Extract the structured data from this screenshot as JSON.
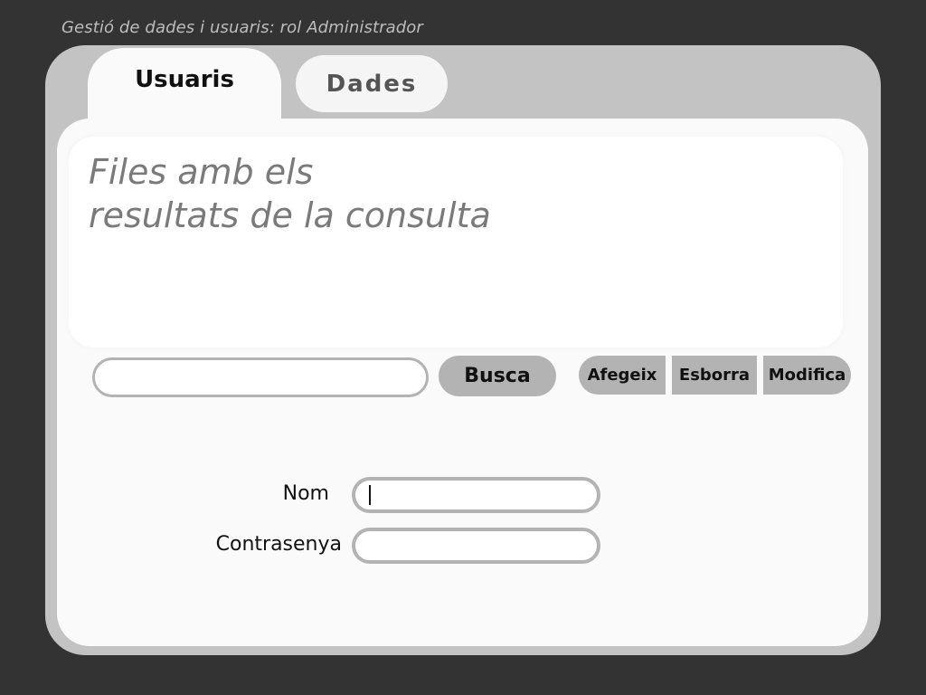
{
  "app": {
    "title": "Gestió de dades i usuaris: rol Administrador"
  },
  "tabs": [
    {
      "label": "Usuaris",
      "active": true
    },
    {
      "label": "Dades",
      "active": false
    }
  ],
  "results": {
    "placeholder_text": "Files amb els\nresultats de la consulta"
  },
  "search": {
    "value": "",
    "placeholder": "",
    "button_label": "Busca"
  },
  "actions": {
    "add_label": "Afegeix",
    "delete_label": "Esborra",
    "modify_label": "Modifica"
  },
  "form": {
    "name_label": "Nom",
    "name_value": "",
    "password_label": "Contrasenya",
    "password_value": ""
  },
  "colors": {
    "background": "#333333",
    "window": "#c3c3c3",
    "panel": "#fafafa",
    "button": "#b3b3b3",
    "muted_text": "#7a7a7a"
  }
}
